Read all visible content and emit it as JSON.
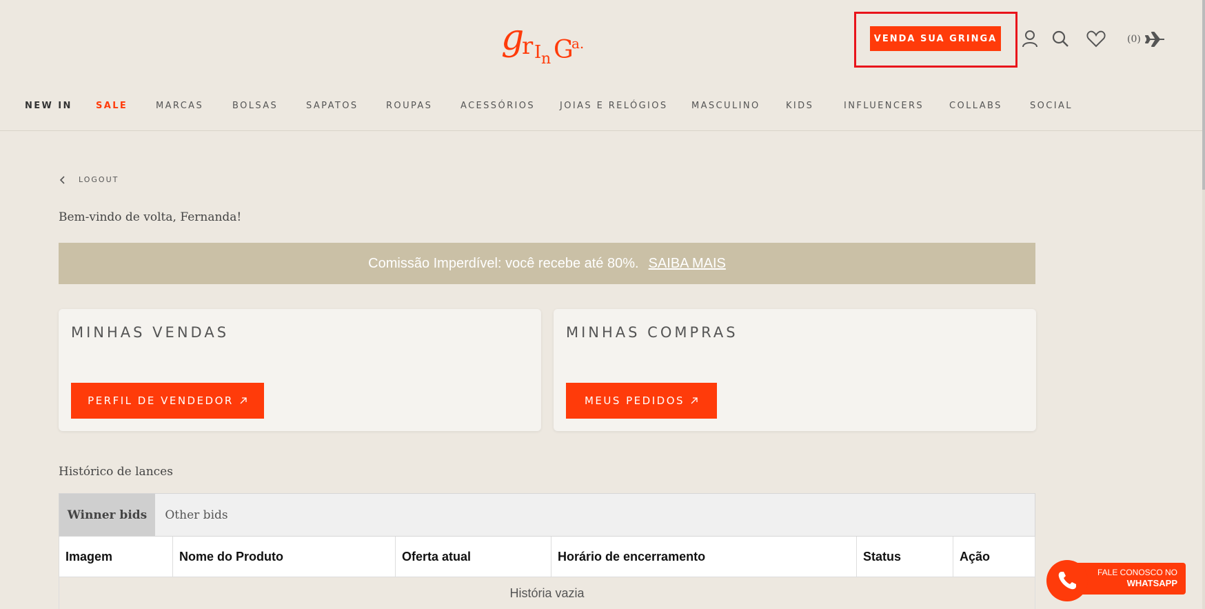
{
  "header": {
    "logo_text": "griGa.",
    "sell_button": "VENDA SUA GRINGA",
    "cart_count": "(0)",
    "icons": [
      "user-icon",
      "search-icon",
      "heart-icon",
      "airplane-icon"
    ]
  },
  "nav": [
    {
      "label": "NEW IN"
    },
    {
      "label": "SALE"
    },
    {
      "label": "MARCAS"
    },
    {
      "label": "BOLSAS"
    },
    {
      "label": "SAPATOS"
    },
    {
      "label": "ROUPAS"
    },
    {
      "label": "ACESSÓRIOS"
    },
    {
      "label": "JOIAS E RELÓGIOS"
    },
    {
      "label": "MASCULINO"
    },
    {
      "label": "KIDS"
    },
    {
      "label": "INFLUENCERS"
    },
    {
      "label": "COLLABS"
    },
    {
      "label": "SOCIAL"
    }
  ],
  "account": {
    "logout": "LOGOUT",
    "welcome": "Bem-vindo de volta, Fernanda!",
    "promo_text": "Comissão Imperdível: você recebe até 80%.",
    "promo_link": "SAIBA MAIS",
    "sales_card": {
      "title": "MINHAS VENDAS",
      "button": "PERFIL DE VENDEDOR"
    },
    "purchases_card": {
      "title": "MINHAS COMPRAS",
      "button": "MEUS PEDIDOS"
    }
  },
  "bids": {
    "title": "Histórico de lances",
    "tabs": [
      "Winner bids",
      "Other bids"
    ],
    "columns": [
      "Imagem",
      "Nome do Produto",
      "Oferta atual",
      "Horário de encerramento",
      "Status",
      "Ação"
    ],
    "empty": "História vazia"
  },
  "whatsapp": {
    "line1": "FALE CONOSCO NO",
    "line2": "WHATSAPP"
  },
  "colors": {
    "accent": "#ff3b0a",
    "background": "#ede8e0",
    "promo_bg": "#cac0a6",
    "highlight": "#e8141b"
  }
}
